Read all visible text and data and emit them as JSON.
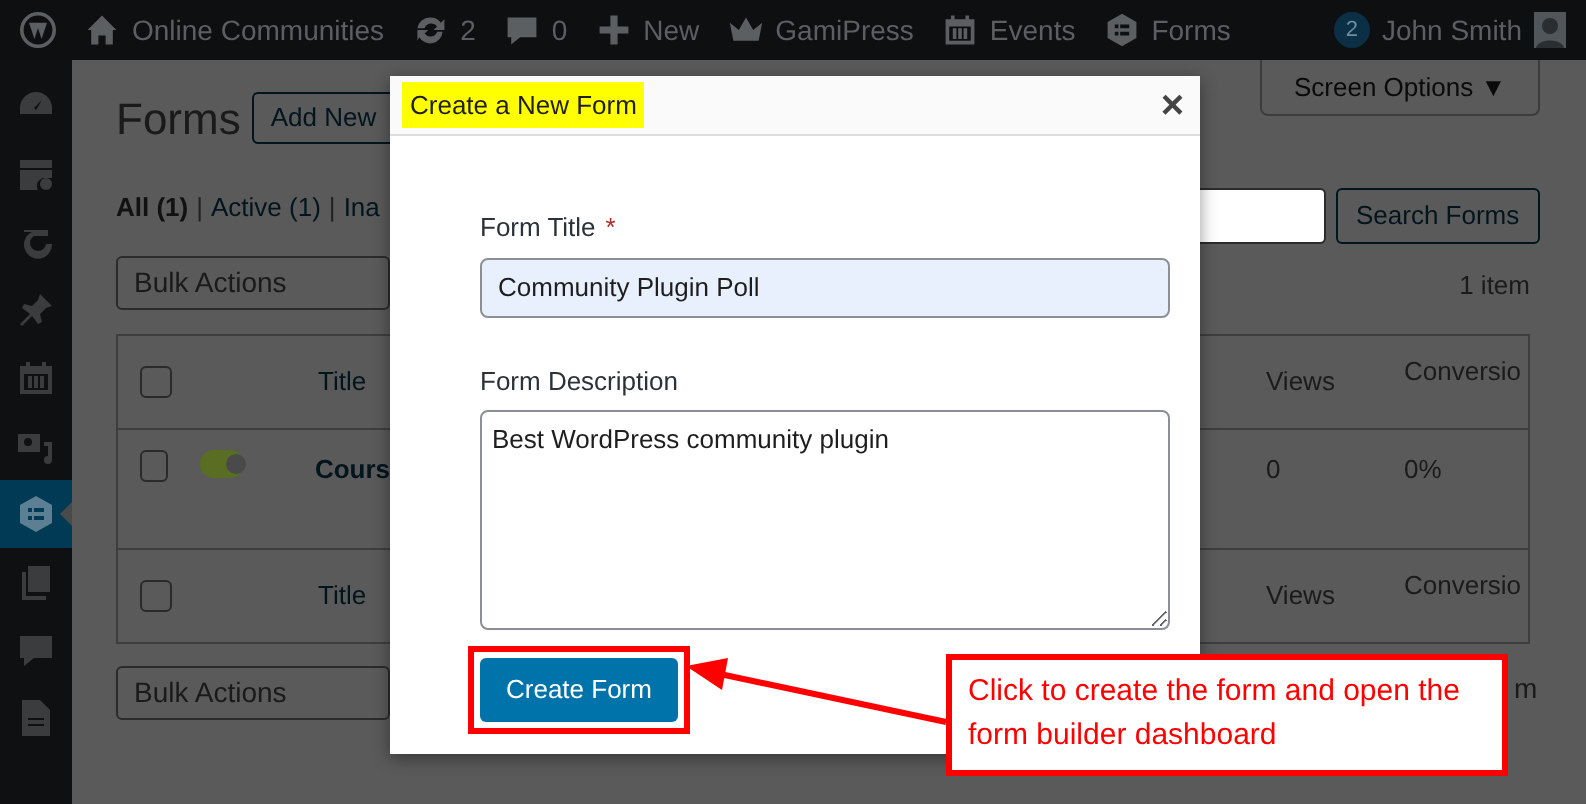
{
  "admin_bar": {
    "items": [
      {
        "kind": "wp"
      },
      {
        "kind": "home",
        "label": "Online Communities"
      },
      {
        "kind": "updates",
        "label": "2"
      },
      {
        "kind": "comments",
        "label": "0"
      },
      {
        "kind": "new",
        "label": "New"
      },
      {
        "kind": "crown",
        "label": "GamiPress"
      },
      {
        "kind": "calendar",
        "label": "Events"
      },
      {
        "kind": "forms",
        "label": "Forms"
      }
    ],
    "notification_count": "2",
    "user": "John Smith"
  },
  "sidebar": {
    "items": [
      {
        "selected": false
      },
      {
        "selected": false
      },
      {
        "selected": false
      },
      {
        "selected": false
      },
      {
        "selected": false
      },
      {
        "selected": false
      },
      {
        "selected": true
      },
      {
        "selected": false
      },
      {
        "selected": false
      },
      {
        "selected": false
      }
    ]
  },
  "page": {
    "title": "Forms",
    "add_new": "Add New",
    "screen_options": "Screen Options ▼",
    "filters": [
      {
        "label": "All",
        "count": "(1)",
        "selected": true
      },
      {
        "label": "Active",
        "count": "(1)",
        "selected": false
      },
      {
        "label": "Ina",
        "selected": false
      }
    ],
    "filter_separators": [
      "|",
      "|"
    ],
    "bulk_actions_top": "Bulk Actions",
    "bulk_actions_bottom": "Bulk Actions",
    "search_button": "Search Forms",
    "item_count": "1 item",
    "item_count_bottom": "m",
    "table": {
      "header_checked": false,
      "footer_checked": false,
      "columns": [
        "Title",
        "Views",
        "Conversio"
      ],
      "footer_columns": [
        "Title",
        "Views",
        "Conversio"
      ],
      "rows": [
        {
          "checked": false,
          "active": true,
          "title": "Cours",
          "views": "0",
          "conversion": "0%"
        }
      ]
    }
  },
  "modal": {
    "title": "Create a New Form",
    "close": "×",
    "fields": [
      {
        "kind": "input",
        "label": "Form Title",
        "required_mark": "*",
        "value": "Community Plugin Poll"
      },
      {
        "kind": "textarea",
        "label": "Form Description",
        "value": "Best WordPress community plugin"
      }
    ],
    "button": "Create Form"
  },
  "annotation": {
    "text": "Click to create the form and open the form builder dashboard"
  }
}
